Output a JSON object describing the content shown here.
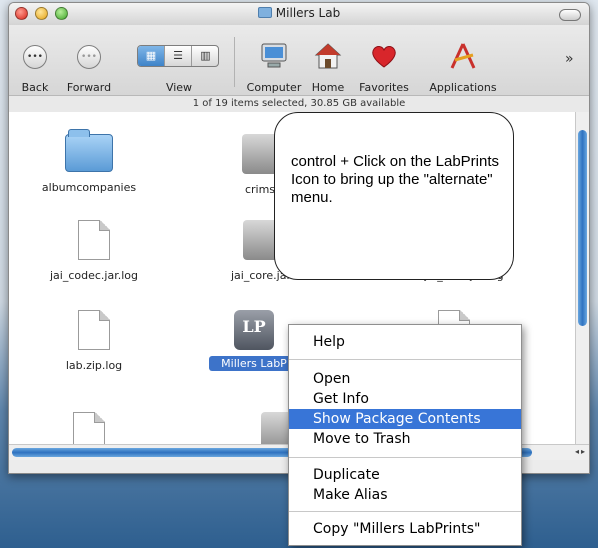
{
  "window": {
    "title": "Millers Lab"
  },
  "toolbar": {
    "back": "Back",
    "forward": "Forward",
    "view": "View",
    "computer": "Computer",
    "home": "Home",
    "favorites": "Favorites",
    "applications": "Applications",
    "overflow": "»"
  },
  "status": {
    "text": "1 of 19 items selected, 30.85 GB available"
  },
  "items": [
    {
      "label": "albumcompanies"
    },
    {
      "label": "crims"
    },
    {
      "label": "jai_codec.jar.log"
    },
    {
      "label": "jai_core.jar"
    },
    {
      "label": "jai_core.jar.log"
    },
    {
      "label": "lab.zip.log"
    },
    {
      "label": "Millers LabP"
    }
  ],
  "lp_icon_text": "LP",
  "callout": {
    "text": "control + Click on the LabPrints Icon to bring up the \"alternate\" menu."
  },
  "context_menu": {
    "help": "Help",
    "open": "Open",
    "get_info": "Get Info",
    "show_package_contents": "Show Package Contents",
    "move_to_trash": "Move to Trash",
    "duplicate": "Duplicate",
    "make_alias": "Make Alias",
    "copy": "Copy \"Millers LabPrints\""
  },
  "colors": {
    "selection": "#3875d7",
    "folder": "#5b9bd6"
  }
}
